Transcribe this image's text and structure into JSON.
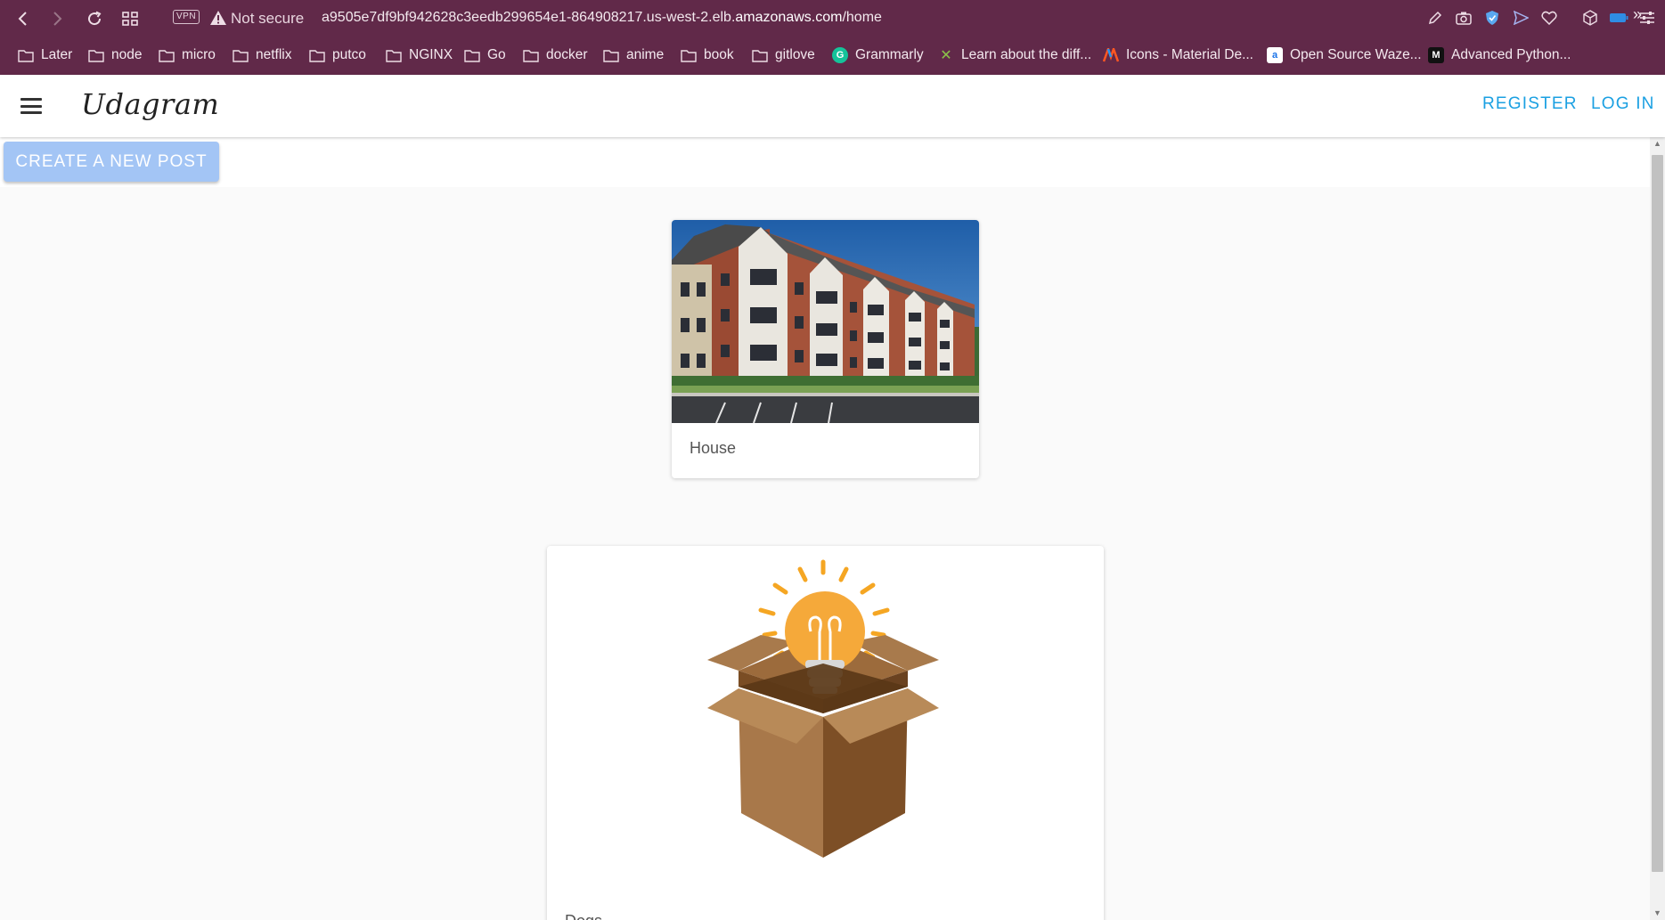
{
  "browser": {
    "vpn_label": "VPN",
    "security_label": "Not secure",
    "url_prefix": "a9505e7df9bf942628c3eedb299654e1-864908217.us-west-2.elb.",
    "url_host": "amazonaws.com",
    "url_path": "/home",
    "accent_color": "#612949"
  },
  "bookmarks": [
    {
      "label": "Later",
      "icon": "folder-icon"
    },
    {
      "label": "node",
      "icon": "folder-icon"
    },
    {
      "label": "micro",
      "icon": "folder-icon"
    },
    {
      "label": "netflix",
      "icon": "folder-icon"
    },
    {
      "label": "putco",
      "icon": "folder-icon"
    },
    {
      "label": "NGINX",
      "icon": "folder-icon"
    },
    {
      "label": "Go",
      "icon": "folder-icon"
    },
    {
      "label": "docker",
      "icon": "folder-icon"
    },
    {
      "label": "anime",
      "icon": "folder-icon"
    },
    {
      "label": "book",
      "icon": "folder-icon"
    },
    {
      "label": "gitlove",
      "icon": "folder-icon"
    },
    {
      "label": "Grammarly",
      "icon": "grammarly-icon"
    },
    {
      "label": "Learn about the diff...",
      "icon": "x-icon"
    },
    {
      "label": "Icons - Material De...",
      "icon": "material-icon"
    },
    {
      "label": "Open Source Waze...",
      "icon": "amazon-icon"
    },
    {
      "label": "Advanced Python...",
      "icon": "medium-icon"
    }
  ],
  "app": {
    "brand": "Udagram",
    "register_label": "REGISTER",
    "login_label": "LOG IN",
    "create_post_label": "CREATE A NEW POST",
    "link_color": "#1ba0e2",
    "button_color": "#a3c5f5"
  },
  "feed": [
    {
      "caption": "House",
      "image": "apartment-building-photo"
    },
    {
      "caption": "Dogs",
      "image": "lightbulb-in-box-illustration"
    }
  ]
}
